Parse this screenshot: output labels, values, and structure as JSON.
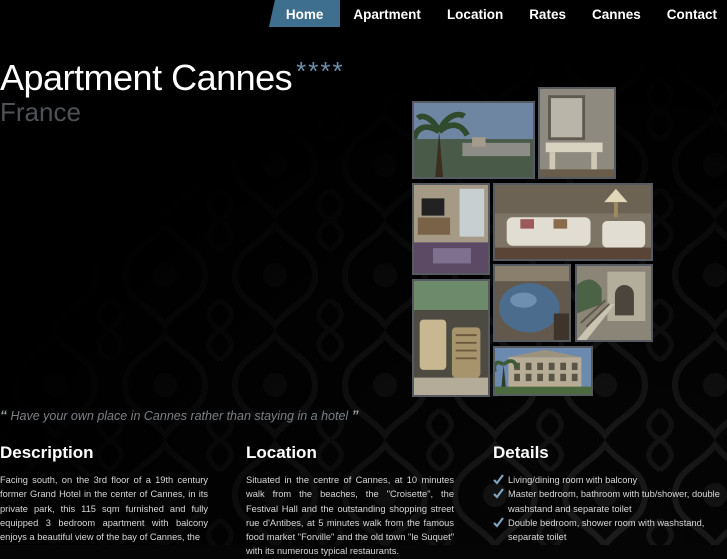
{
  "nav": {
    "items": [
      {
        "label": "Home",
        "active": true
      },
      {
        "label": "Apartment",
        "active": false
      },
      {
        "label": "Location",
        "active": false
      },
      {
        "label": "Rates",
        "active": false
      },
      {
        "label": "Cannes",
        "active": false
      },
      {
        "label": "Contact",
        "active": false
      }
    ]
  },
  "header": {
    "title": "Apartment Cannes",
    "stars": "****",
    "subtitle": "France"
  },
  "gallery": {
    "photos": [
      "palm-trees-bay-view",
      "room-with-mirror-desk",
      "bedroom-with-tv",
      "living-room-sofas",
      "balcony-chairs",
      "bed-blue-cover",
      "palace-staircase",
      "grand-hotel-facade"
    ]
  },
  "quote": {
    "open_mark": "“",
    "text": "Have your own place in Cannes rather than staying in a hotel",
    "close_mark": "”"
  },
  "description": {
    "heading": "Description",
    "text": "Facing south, on the 3rd floor of a 19th century former Grand Hotel in the center of Cannes, in its private park, this 115 sqm furnished and fully equipped 3 bedroom apartment with balcony enjoys a beautiful view of the bay of Cannes, the"
  },
  "location": {
    "heading": "Location",
    "text": "Situated in the centre of Cannes, at 10 minutes walk from the beaches, the \"Croisette\", the Festival Hall and the outstanding shopping street rue d'Antibes, at 5 minutes walk from the famous food market \"Forville\" and the old town \"le Suquet\" with its numerous typical restaurants."
  },
  "details": {
    "heading": "Details",
    "items": [
      "Living/dining room with balcony",
      "Master bedroom, bathroom with tub/shower, double washstand and separate toilet",
      "Double bedroom, shower room with washstand, separate toilet"
    ]
  },
  "colors": {
    "accent": "#3f6f8f",
    "stars": "#6e8fa8",
    "background": "#050505"
  }
}
